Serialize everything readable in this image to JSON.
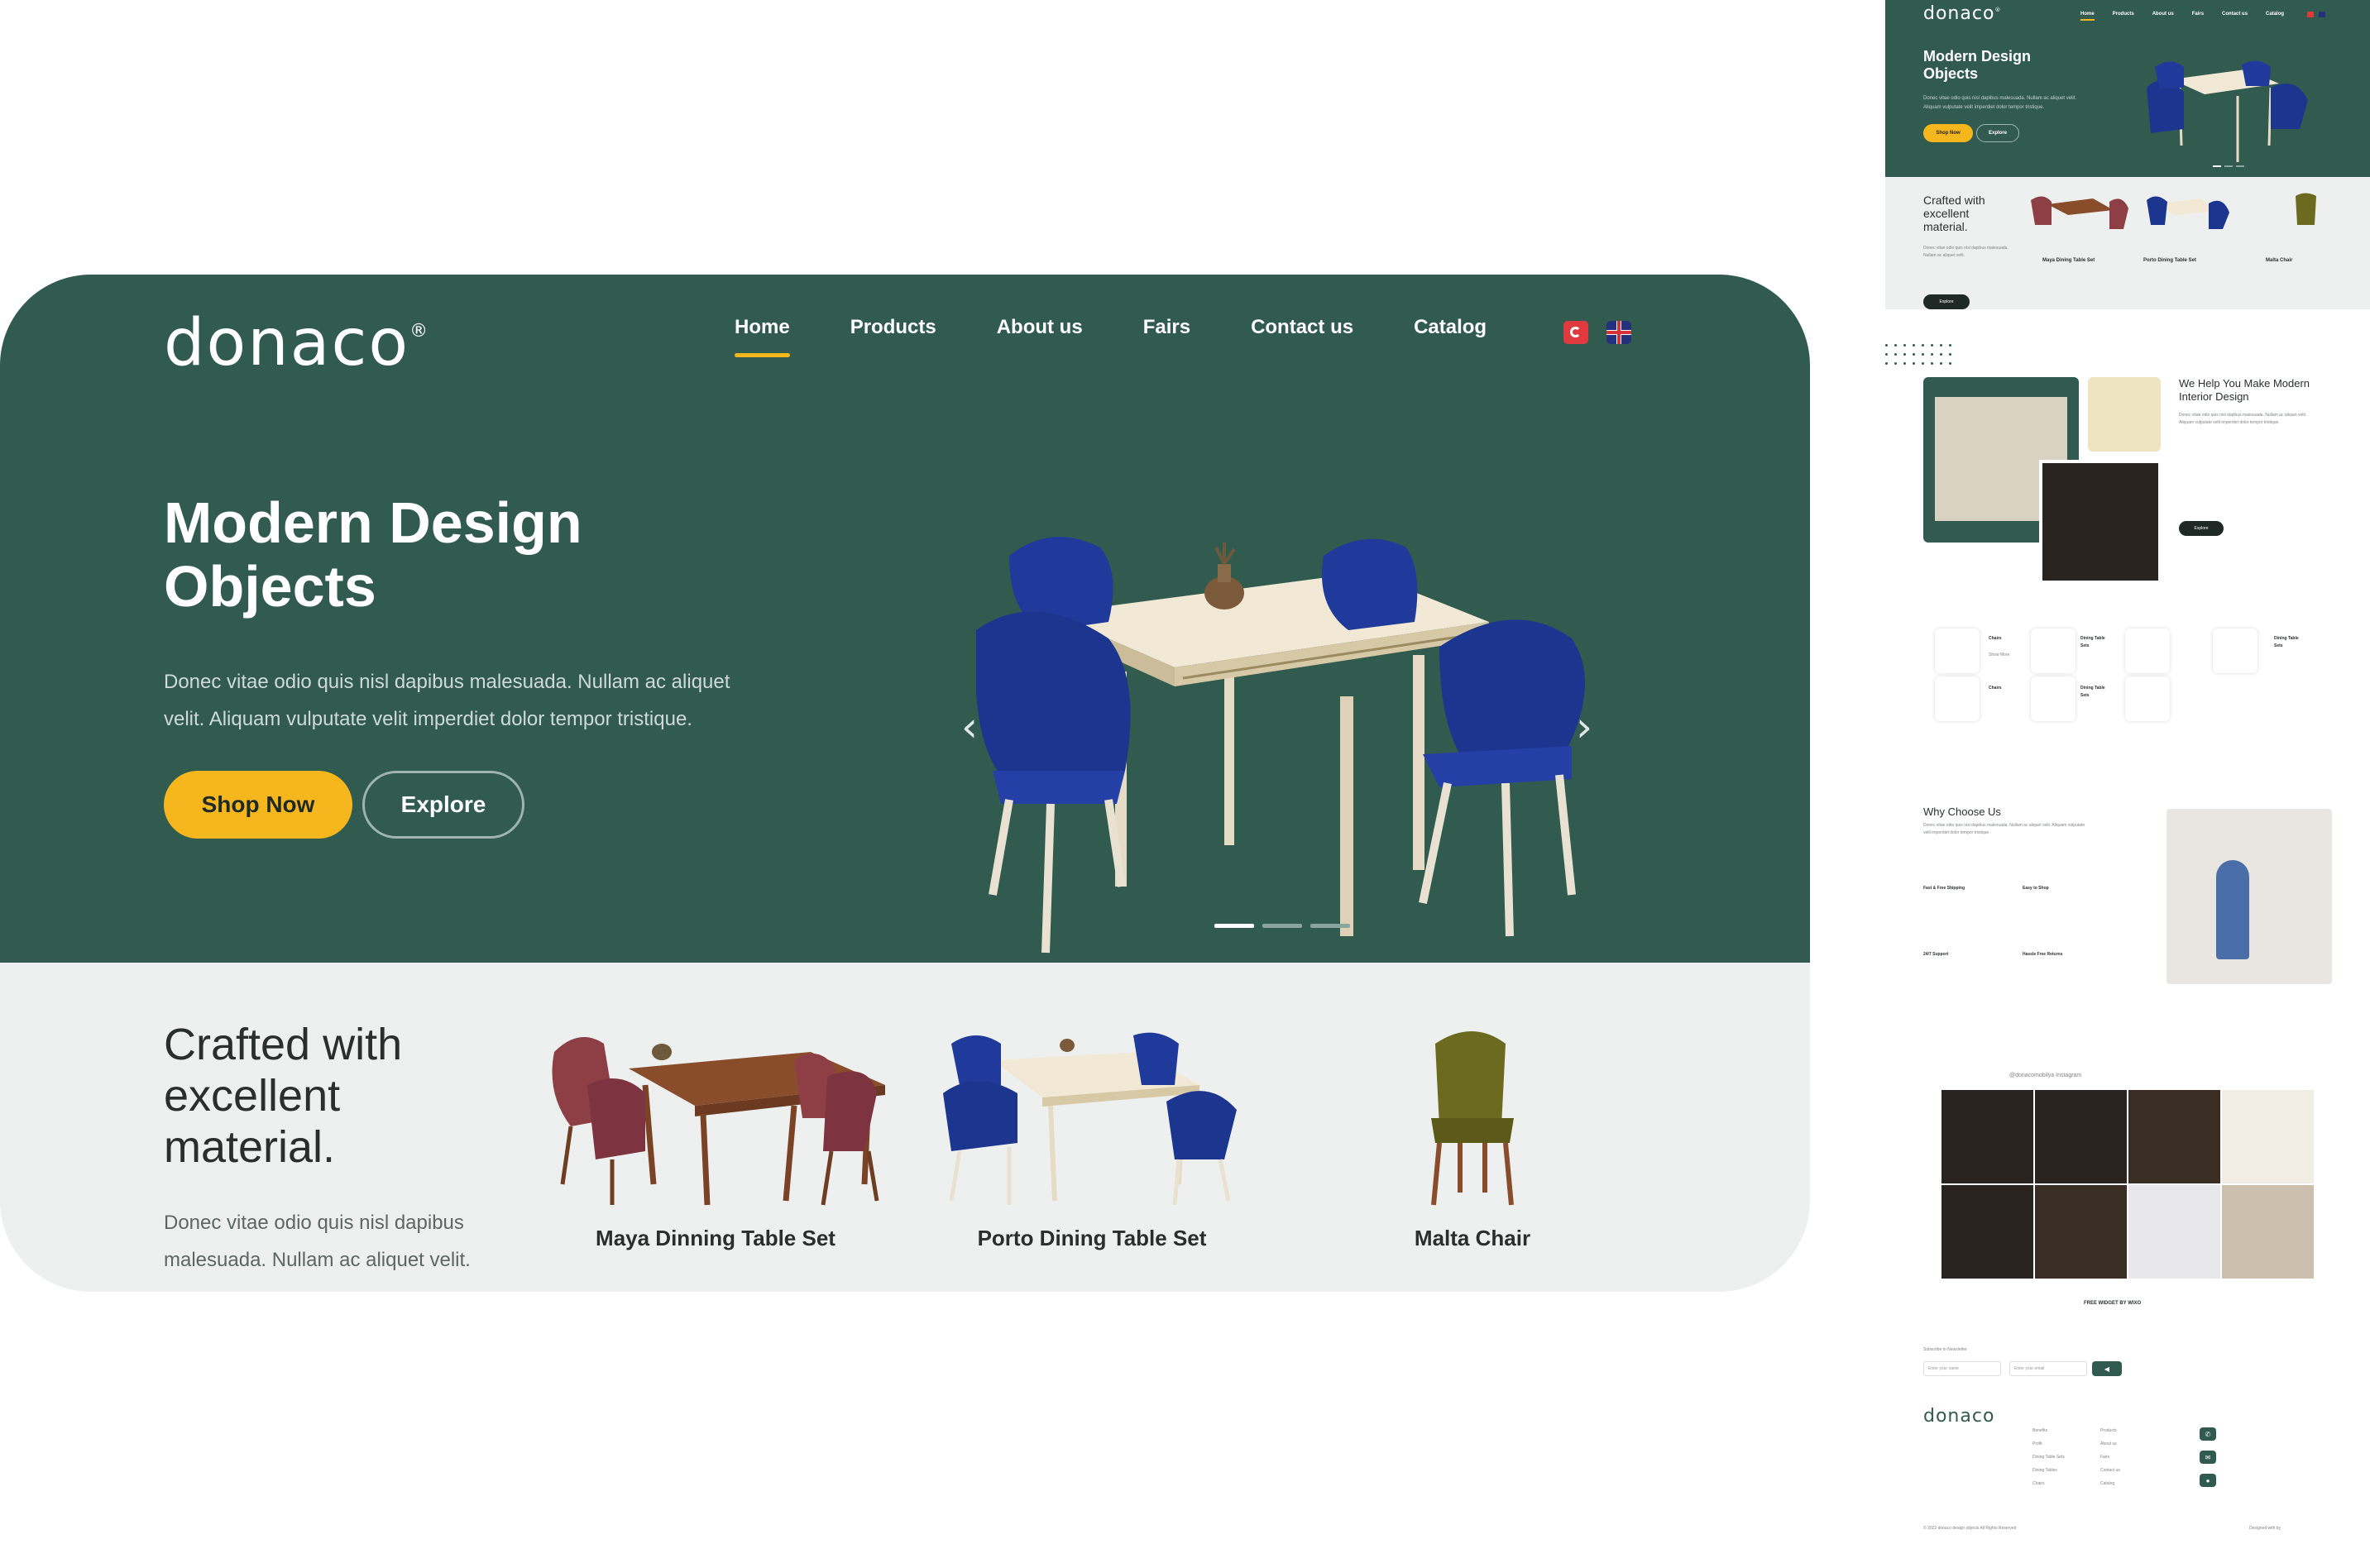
{
  "brand": {
    "logo": "donaco",
    "registered": "®"
  },
  "nav": {
    "items": [
      "Home",
      "Products",
      "About us",
      "Fairs",
      "Contact us",
      "Catalog"
    ],
    "active": "Home"
  },
  "hero": {
    "title": "Modern Design Objects",
    "text": "Donec vitae odio quis nisl dapibus malesuada. Nullam ac aliquet velit. Aliquam vulputate velit imperdiet dolor tempor tristique.",
    "shop_label": "Shop Now",
    "explore_label": "Explore",
    "slide_count": 3,
    "active_slide": 1
  },
  "crafted": {
    "title": "Crafted with excellent material.",
    "text": "Donec vitae odio quis nisl dapibus malesuada. Nullam ac aliquet velit.",
    "products": [
      "Maya Dinning Table Set",
      "Porto Dining Table Set",
      "Malta Chair"
    ]
  },
  "preview": {
    "crafted_products": [
      "Maya Dining Table Set",
      "Porto Dining Table Set",
      "Malta Chair"
    ],
    "crafted_explore": "Explore",
    "interior_title": "We Help You Make Modern Interior Design",
    "interior_explore": "Explore",
    "why_title": "Why Choose Us",
    "features": [
      "Fast & Free Shipping",
      "Easy to Shop",
      "24/7 Support",
      "Hassle Free Returns"
    ],
    "category_cards": [
      "Chairs",
      "Dining Table Sets",
      "Dining Table Sets",
      "Chairs",
      "Dining Table Sets"
    ],
    "show_more": "Show More",
    "instagram_handle": "@donacomobilya Instagram",
    "instagram_widget": "FREE WIDGET BY WIXO",
    "newsletter_label": "Subscribe to Newsletter",
    "newsletter_name_placeholder": "Enter your name",
    "newsletter_email_placeholder": "Enter your email",
    "footer_links_1": [
      "Benefits",
      "Profit",
      "Dining Table Sets",
      "Dining Tables",
      "Chairs"
    ],
    "footer_links_2": [
      "Products",
      "About us",
      "Fairs",
      "Contact us",
      "Catalog"
    ],
    "copyright": "© 2022 donaco design objects All Rights Reserved",
    "designed_by": "Designed with by"
  },
  "colors": {
    "primary_green": "#325b4f",
    "accent_yellow": "#f5b71d",
    "light_bg": "#eef0f0",
    "chair_blue": "#1f3a9a"
  }
}
